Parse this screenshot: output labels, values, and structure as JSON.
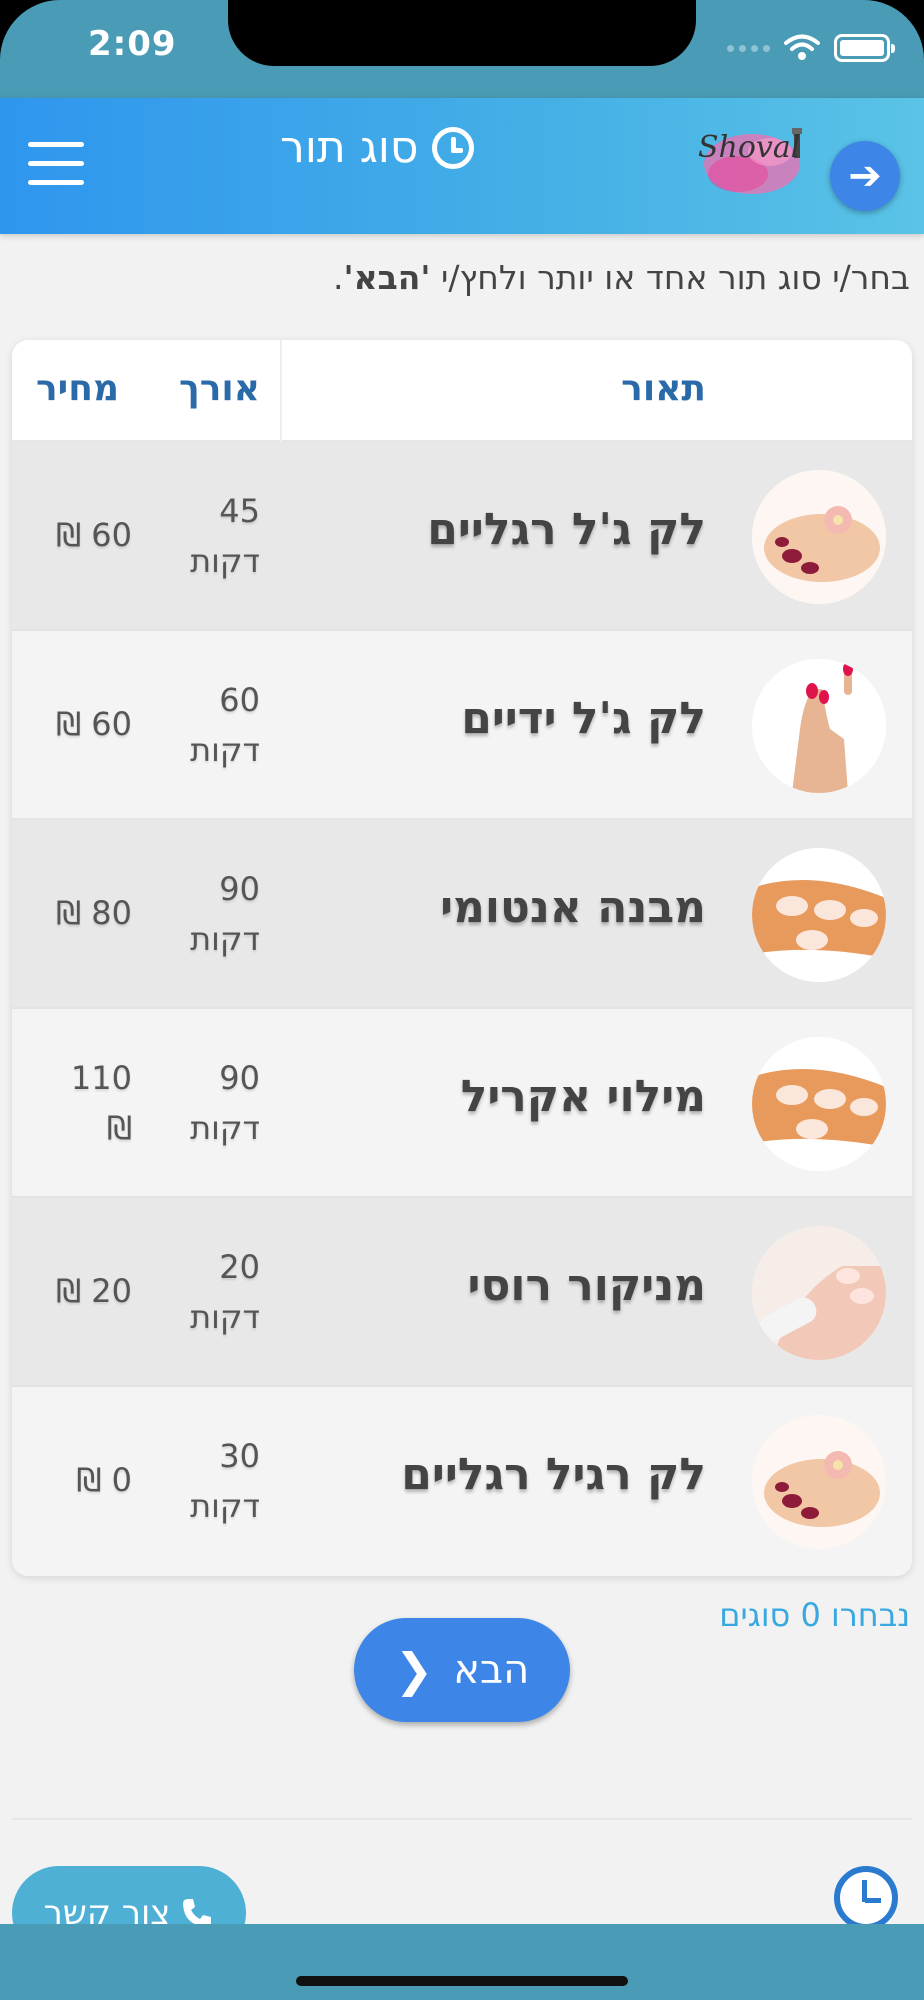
{
  "status": {
    "time": "2:09"
  },
  "header": {
    "title": "סוג תור",
    "logo_text": "Shoval",
    "back_arrow": "➔"
  },
  "instruction": {
    "prefix": "בחר/י סוג תור אחד או יותר ולחץ/י ",
    "highlight": "'הבא'",
    "suffix": "."
  },
  "table": {
    "columns": {
      "description": "תאור",
      "duration": "אורך",
      "price": "מחיר"
    },
    "rows": [
      {
        "name": "לק ג'ל רגליים",
        "duration": "45",
        "duration_unit": "דקות",
        "price": "60 ₪",
        "image": "feet-nails-icon"
      },
      {
        "name": "לק ג'ל ידיים",
        "duration": "60",
        "duration_unit": "דקות",
        "price": "60 ₪",
        "image": "hand-nails-icon"
      },
      {
        "name": "מבנה אנטומי",
        "duration": "90",
        "duration_unit": "דקות",
        "price": "80 ₪",
        "image": "french-nails-icon"
      },
      {
        "name": "מילוי אקריל",
        "duration": "90",
        "duration_unit": "דקות",
        "price_line1": "110",
        "price_line2": "₪",
        "image": "french-nails-icon"
      },
      {
        "name": "מניקור רוסי",
        "duration": "20",
        "duration_unit": "דקות",
        "price": "20 ₪",
        "image": "nail-file-icon"
      },
      {
        "name": "לק רגיל רגליים",
        "duration": "30",
        "duration_unit": "דקות",
        "price": "0 ₪",
        "image": "feet-nails-icon"
      }
    ]
  },
  "footer": {
    "selected_count": "נבחרו 0 סוגים",
    "next_label": "הבא",
    "contact_label": "צור קשר"
  },
  "colors": {
    "accent": "#3d86e8",
    "header": "#45b0e6",
    "heading_text": "#2b6aa8",
    "link": "#3aa8e0"
  }
}
